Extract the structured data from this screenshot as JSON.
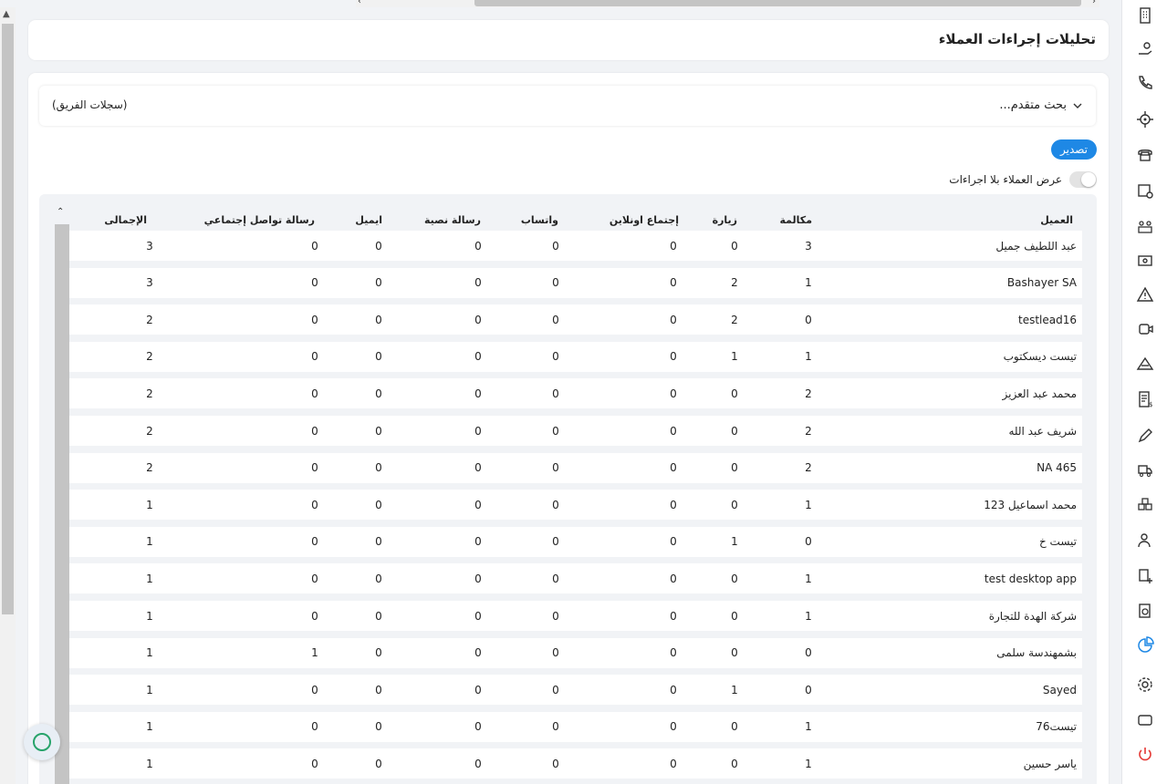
{
  "page": {
    "title": "تحليلات إجراءات العملاء"
  },
  "filters": {
    "advanced_search": "بحث متقدم...",
    "team_records": "(سجلات الفريق)"
  },
  "actions": {
    "export": "تصدير",
    "toggle_label": "عرض العملاء بلا اجراءات"
  },
  "table": {
    "headers": [
      "العميل",
      "مكالمة",
      "زيارة",
      "إجتماع اونلاين",
      "واتساب",
      "رسالة نصية",
      "ايميل",
      "رسالة تواصل إجتماعي",
      "الإجمالى"
    ],
    "rows": [
      [
        "عبد اللطيف جميل",
        "3",
        "0",
        "0",
        "0",
        "0",
        "0",
        "0",
        "3"
      ],
      [
        "Bashayer SA",
        "1",
        "2",
        "0",
        "0",
        "0",
        "0",
        "0",
        "3"
      ],
      [
        "testlead16",
        "0",
        "2",
        "0",
        "0",
        "0",
        "0",
        "0",
        "2"
      ],
      [
        "تيست ديسكتوب",
        "1",
        "1",
        "0",
        "0",
        "0",
        "0",
        "0",
        "2"
      ],
      [
        "محمد عبد العزيز",
        "2",
        "0",
        "0",
        "0",
        "0",
        "0",
        "0",
        "2"
      ],
      [
        "شريف عبد الله",
        "2",
        "0",
        "0",
        "0",
        "0",
        "0",
        "0",
        "2"
      ],
      [
        "NA 465",
        "2",
        "0",
        "0",
        "0",
        "0",
        "0",
        "0",
        "2"
      ],
      [
        "محمد اسماعيل 123",
        "1",
        "0",
        "0",
        "0",
        "0",
        "0",
        "0",
        "1"
      ],
      [
        "تيست خ",
        "0",
        "1",
        "0",
        "0",
        "0",
        "0",
        "0",
        "1"
      ],
      [
        "test desktop app",
        "1",
        "0",
        "0",
        "0",
        "0",
        "0",
        "0",
        "1"
      ],
      [
        "شركة الهدة للتجارة",
        "1",
        "0",
        "0",
        "0",
        "0",
        "0",
        "0",
        "1"
      ],
      [
        "بشمهندسة سلمى",
        "0",
        "0",
        "0",
        "0",
        "0",
        "0",
        "1",
        "1"
      ],
      [
        "Sayed",
        "0",
        "1",
        "0",
        "0",
        "0",
        "0",
        "0",
        "1"
      ],
      [
        "تيست76",
        "1",
        "0",
        "0",
        "0",
        "0",
        "0",
        "0",
        "1"
      ],
      [
        "ياسر حسين",
        "1",
        "0",
        "0",
        "0",
        "0",
        "0",
        "0",
        "1"
      ]
    ]
  },
  "sidebar": {
    "icons": [
      "building-icon",
      "hand-coin-icon",
      "phone-call-icon",
      "target-icon",
      "desk-phone-icon",
      "calendar-add-icon",
      "team-icon",
      "cash-icon",
      "warning-icon",
      "video-call-icon",
      "network-icon",
      "invoice-icon",
      "pen-icon",
      "truck-icon",
      "boxes-icon",
      "user-settings-icon",
      "add-document-icon",
      "file-sync-icon",
      "analytics-icon",
      "settings-icon",
      "screen-icon",
      "power-icon"
    ],
    "active_icon": "analytics-icon",
    "accent": "#1e88e5",
    "danger": "#e53935"
  }
}
